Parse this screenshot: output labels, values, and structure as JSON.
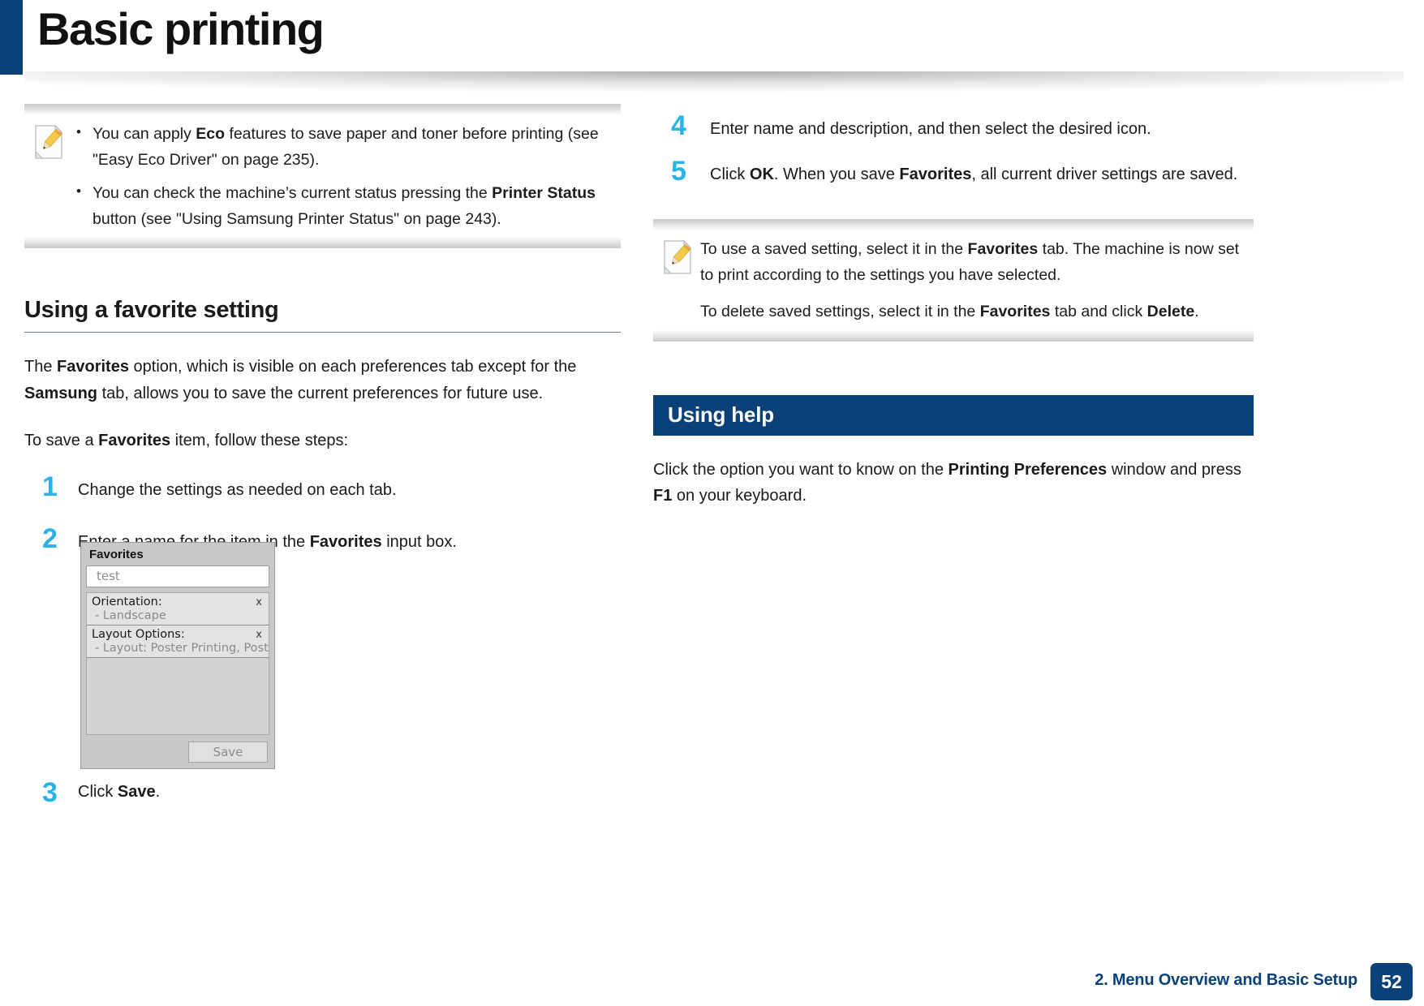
{
  "page": {
    "title": "Basic printing",
    "accent_color": "#0a4179",
    "step_number_color": "#2bb3e8"
  },
  "left_column": {
    "note": {
      "icon": "note-pencil-icon",
      "bullets": [
        "You can apply Eco features to save paper and toner before printing (see \"Easy Eco Driver\" on page 235).",
        "You can check the machine’s current status pressing the Printer Status button (see \"Using Samsung Printer Status\" on page 243)."
      ]
    },
    "section": {
      "heading": "Using a favorite setting",
      "paragraphs": [
        "The Favorites option, which is visible on each preferences tab except for the Samsung tab, allows you to save the current preferences for future use.",
        "To save a Favorites item, follow these steps:"
      ],
      "steps": [
        {
          "number": "1",
          "text": "Change the settings as needed on each tab."
        },
        {
          "number": "2",
          "text": "Enter a name for the item in the Favorites input box."
        },
        {
          "number": "3",
          "text": "Click Save."
        }
      ]
    },
    "dialog": {
      "title": "Favorites",
      "name_input_value": "test",
      "items": [
        {
          "label": "Orientation:",
          "value": "- Landscape",
          "remove": "x"
        },
        {
          "label": "Layout Options:",
          "value": "- Layout: Poster Printing, Post...",
          "remove": "x"
        }
      ],
      "save_button": "Save"
    }
  },
  "right_column": {
    "steps": [
      {
        "number": "4",
        "text": "Enter name and description, and then select the desired icon."
      },
      {
        "number": "5",
        "text": "Click OK. When you save Favorites, all current driver settings are saved."
      }
    ],
    "note": {
      "icon": "note-pencil-icon",
      "paragraphs": [
        "To use a saved setting, select it in the Favorites tab. The machine is now set to print according to the settings you have selected.",
        "To delete saved settings, select it in the Favorites tab and click Delete."
      ]
    },
    "banner": {
      "title": "Using help"
    },
    "body": "Click the option you want to know on the Printing Preferences window and press F1 on your keyboard."
  },
  "footer": {
    "chapter": "2. Menu Overview and Basic Setup",
    "page_number": "52"
  }
}
